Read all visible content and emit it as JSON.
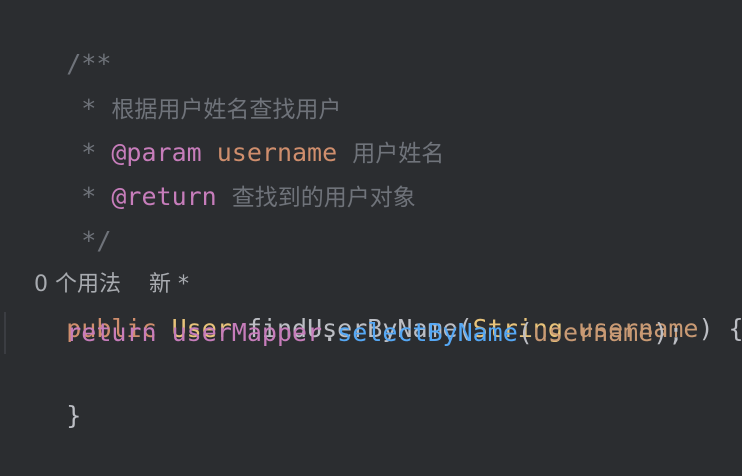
{
  "editor": {
    "lines": {
      "l1": "/**",
      "l2_star": " * ",
      "l2_text": "根据用户姓名查找用户",
      "l3_star": " * ",
      "l3_tag": "@param",
      "l3_name": "username",
      "l3_desc": "用户姓名",
      "l4_star": " * ",
      "l4_tag": "@return",
      "l4_desc": "查找到的用户对象",
      "l5": " */",
      "usage_count": "0 个用法",
      "usage_new": "新 *",
      "sig_public": "public",
      "sig_type": "User",
      "sig_method": "findUserByName",
      "sig_open": "(",
      "sig_param_type": "String",
      "sig_param_name": "username",
      "sig_close": ") {",
      "body_return": "return",
      "body_field": "userMapper",
      "body_dot": ".",
      "body_call": "selectByName",
      "body_open": "(",
      "body_arg": "username",
      "body_close": ");",
      "end_brace": "}"
    }
  },
  "colors": {
    "background": "#2b2d30",
    "doc_comment": "#6f737a",
    "doc_tag": "#c77dbb",
    "keyword": "#cf8e6d",
    "type": "#e8c37a",
    "parameter": "#c99a74",
    "field": "#c77dbb",
    "method_call": "#56a8f5",
    "default_text": "#bcbec4"
  }
}
